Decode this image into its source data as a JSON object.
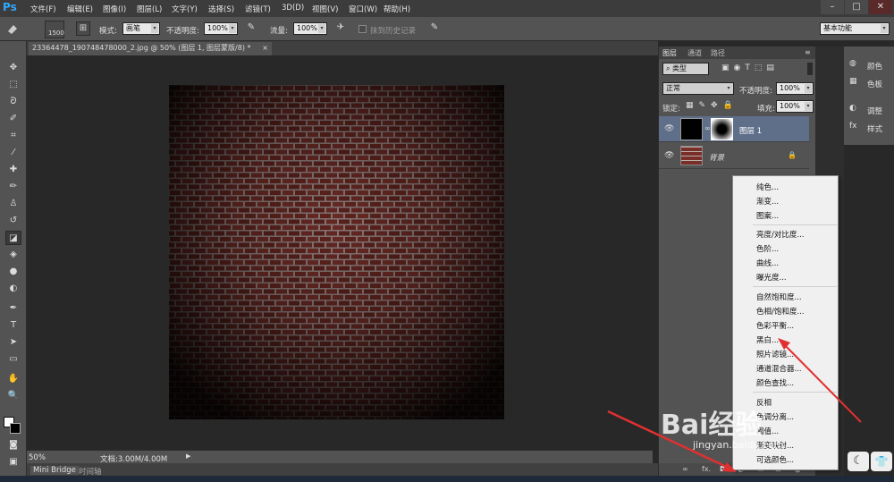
{
  "app": {
    "logo": "Ps"
  },
  "menubar": {
    "items": [
      "文件(F)",
      "编辑(E)",
      "图像(I)",
      "图层(L)",
      "文字(Y)",
      "选择(S)",
      "滤镜(T)",
      "3D(D)",
      "视图(V)",
      "窗口(W)",
      "帮助(H)"
    ],
    "window_buttons": [
      "–",
      "□",
      "✕"
    ]
  },
  "options": {
    "brush_size": "1500",
    "mode_label": "模式:",
    "mode_value": "画笔",
    "opacity_label": "不透明度:",
    "opacity_value": "100%",
    "flow_label": "流量:",
    "flow_value": "100%",
    "history_label": "抹到历史记录",
    "workspace": "基本功能"
  },
  "document": {
    "tab_title": "23364478_190748478000_2.jpg @ 50% (图层 1, 图层蒙版/8) *",
    "tab_close": "×"
  },
  "status": {
    "zoom": "50%",
    "doc_info": "文档:3.00M/4.00M"
  },
  "bottom_tabs": [
    "Mini Bridge",
    "时间轴"
  ],
  "layers_panel": {
    "tabs": [
      "图层",
      "通道",
      "路径"
    ],
    "filter_kind": "类型",
    "blend_mode": "正常",
    "opacity_label": "不透明度:",
    "opacity_value": "100%",
    "lock_label": "锁定:",
    "fill_label": "填充:",
    "fill_value": "100%",
    "layers": [
      {
        "name": "图层 1",
        "selected": true
      },
      {
        "name": "背景",
        "selected": false
      }
    ]
  },
  "right_dock": {
    "items": [
      "颜色",
      "色板",
      "调整",
      "样式"
    ]
  },
  "context_menu": {
    "groups": [
      [
        "纯色...",
        "渐变...",
        "图案..."
      ],
      [
        "亮度/对比度...",
        "色阶...",
        "曲线...",
        "曝光度..."
      ],
      [
        "自然饱和度...",
        "色相/饱和度...",
        "色彩平衡...",
        "黑白...",
        "照片滤镜...",
        "通道混合器...",
        "颜色查找..."
      ],
      [
        "反相",
        "色调分离...",
        "阈值...",
        "渐变映射...",
        "可选颜色..."
      ]
    ]
  },
  "watermark": {
    "brand": "Bai经验",
    "url": "jingyan.baidu.com"
  },
  "colors": {
    "arrow": "#e03030",
    "accent": "#31a8ff",
    "selected_layer": "#5f6f8a"
  }
}
